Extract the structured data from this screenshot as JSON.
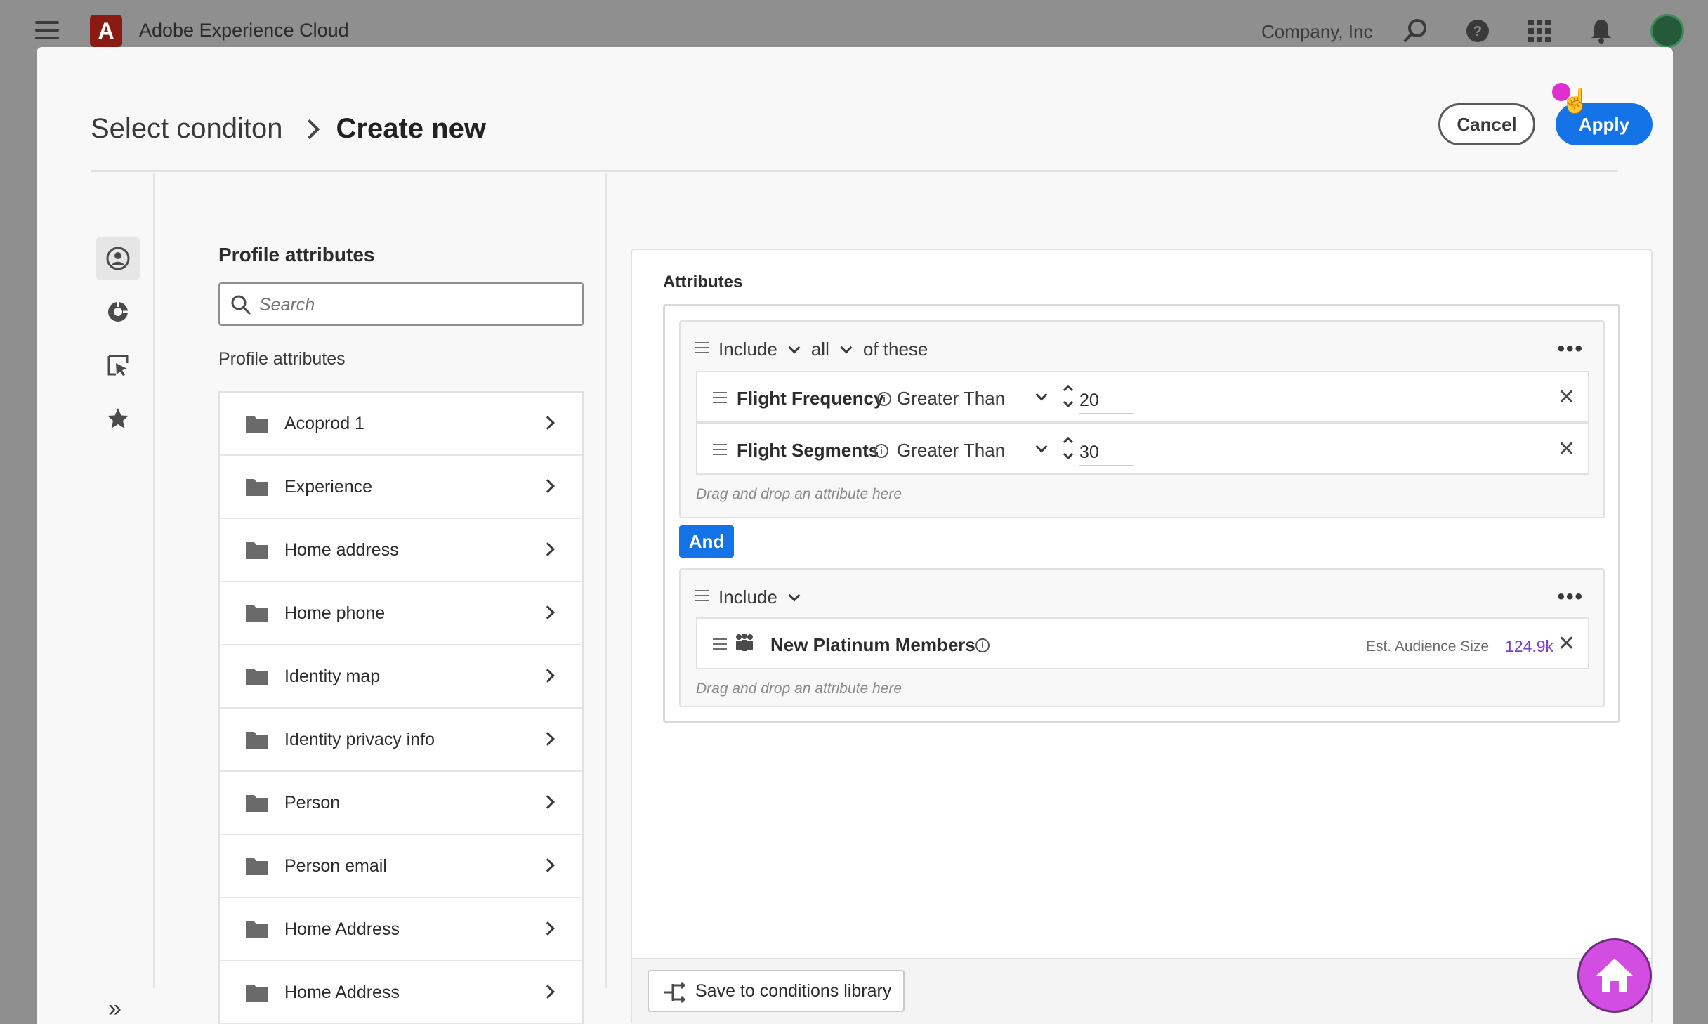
{
  "app": {
    "title": "Adobe Experience Cloud",
    "logo_letter": "A",
    "company": "Company, Inc"
  },
  "modal": {
    "breadcrumb_parent": "Select conditon",
    "breadcrumb_current": "Create new",
    "cancel_label": "Cancel",
    "apply_label": "Apply"
  },
  "attributes_panel": {
    "title": "Profile attributes",
    "search_placeholder": "Search",
    "section_label": "Profile attributes",
    "items": [
      {
        "label": "Acoprod 1"
      },
      {
        "label": "Experience"
      },
      {
        "label": "Home address"
      },
      {
        "label": "Home phone"
      },
      {
        "label": "Identity map"
      },
      {
        "label": "Identity privacy info"
      },
      {
        "label": "Person"
      },
      {
        "label": "Person email"
      },
      {
        "label": "Home Address"
      },
      {
        "label": "Home Address"
      }
    ]
  },
  "builder": {
    "title": "Attributes",
    "group1": {
      "include_label": "Include",
      "quantifier": "all",
      "suffix": "of these",
      "conditions": [
        {
          "name": "Flight Frequency",
          "operator": "Greater Than",
          "value": "20"
        },
        {
          "name": "Flight Segments",
          "operator": "Greater Than",
          "value": "30"
        }
      ],
      "drop_hint": "Drag and drop an attribute here"
    },
    "connector": "And",
    "group2": {
      "include_label": "Include",
      "segment": {
        "name": "New Platinum Members",
        "est_label": "Est. Audience Size",
        "est_value": "124.9k"
      },
      "drop_hint": "Drag and drop an attribute here"
    },
    "save_label": "Save to conditions library"
  },
  "colors": {
    "accent": "#1473e6",
    "audience_value": "#7b3fd1",
    "home_fab": "#d24ee3"
  }
}
